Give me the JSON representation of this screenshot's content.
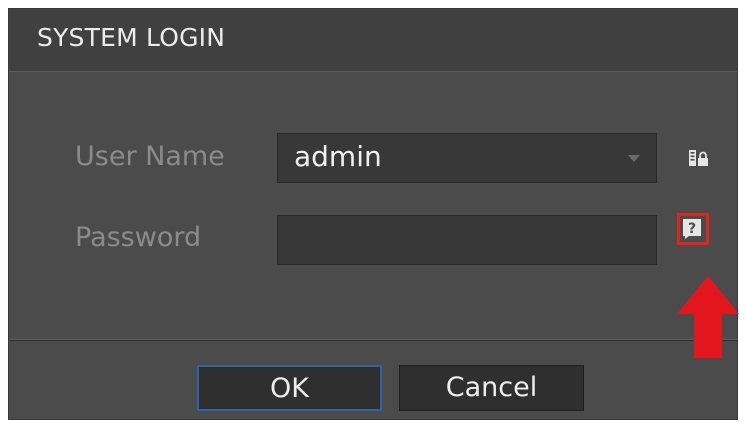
{
  "dialog": {
    "title": "SYSTEM LOGIN"
  },
  "form": {
    "username_label": "User Name",
    "username_value": "admin",
    "password_label": "Password",
    "password_value": ""
  },
  "icons": {
    "user_list": "user-list-icon",
    "password_help": "question-icon",
    "annotation_arrow": "arrow-up-icon"
  },
  "buttons": {
    "ok_label": "OK",
    "cancel_label": "Cancel"
  },
  "colors": {
    "dialog_bg": "#4b4b4b",
    "title_bg": "#404040",
    "field_bg": "#383838",
    "ok_border": "#2e63a8",
    "annotation_red": "#e42121"
  }
}
